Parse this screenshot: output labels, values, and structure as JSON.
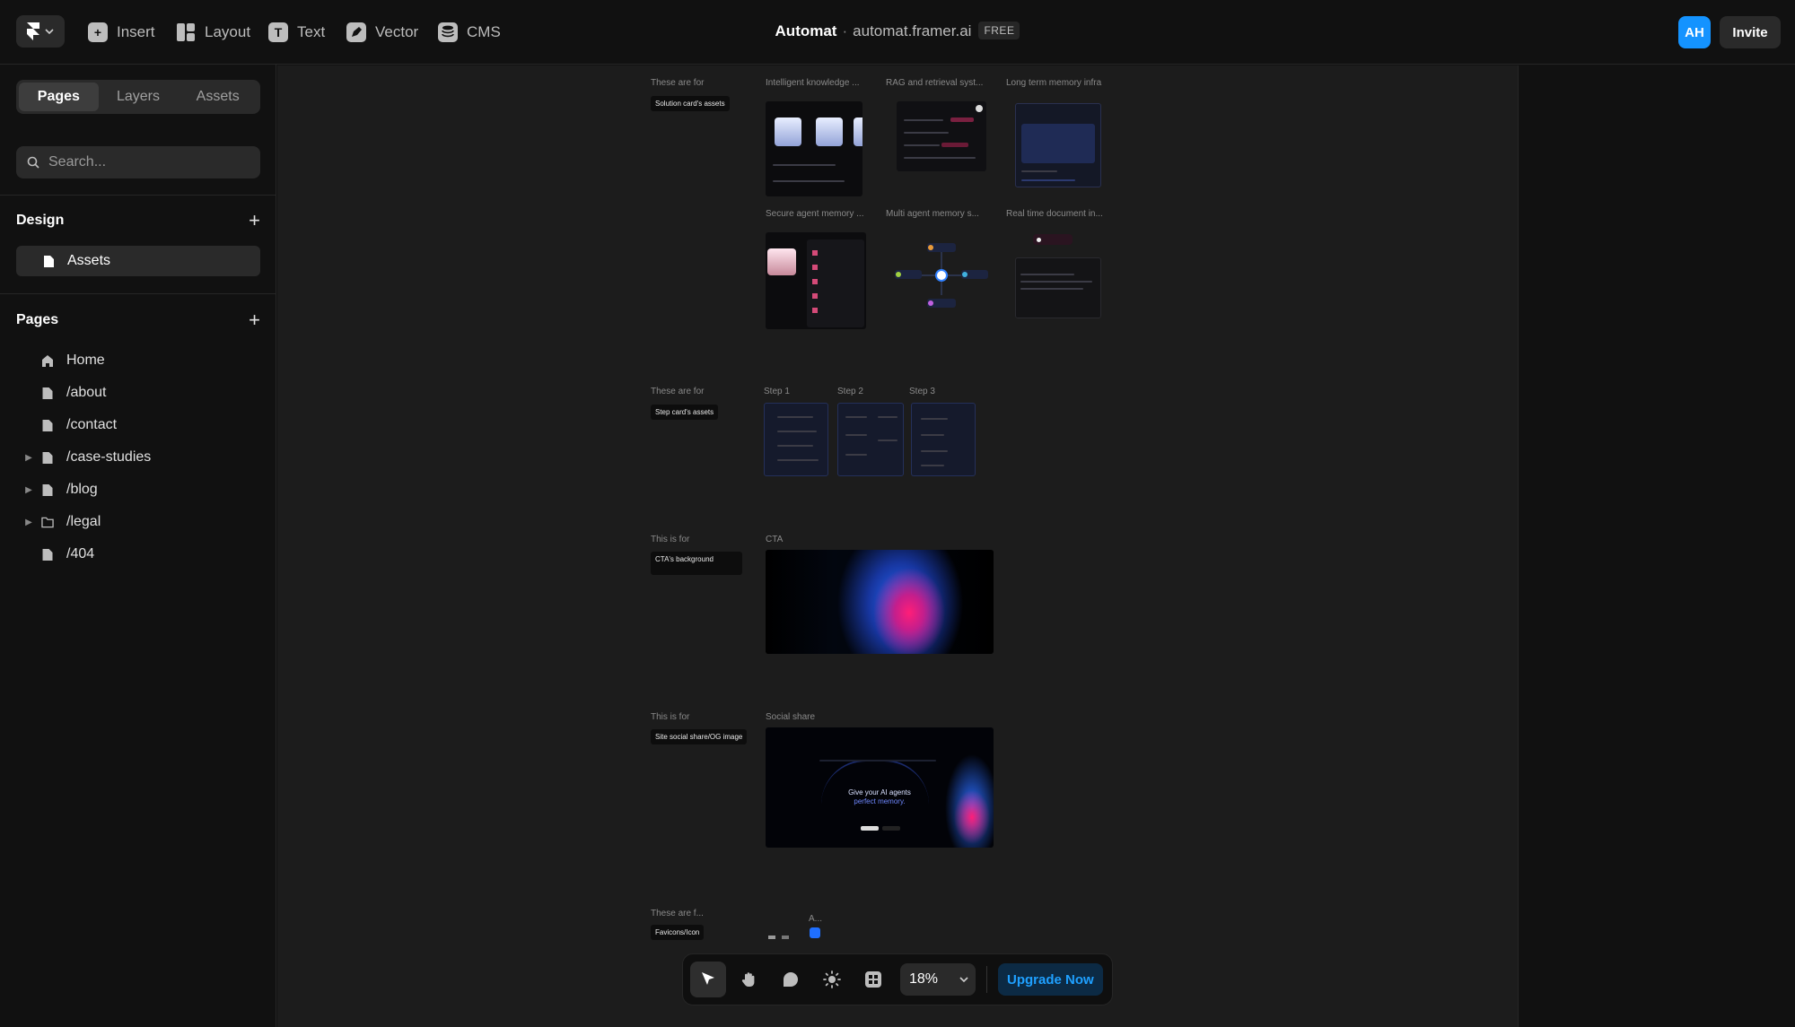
{
  "topbar": {
    "tools": [
      {
        "label": "Insert",
        "icon": "plus-square-icon"
      },
      {
        "label": "Layout",
        "icon": "layout-icon"
      },
      {
        "label": "Text",
        "icon": "text-icon"
      },
      {
        "label": "Vector",
        "icon": "pen-icon"
      },
      {
        "label": "CMS",
        "icon": "database-icon"
      }
    ],
    "project_name": "Automat",
    "separator": "·",
    "project_url": "automat.framer.ai",
    "plan_badge": "FREE",
    "avatar_initials": "AH",
    "invite_label": "Invite"
  },
  "left_panel": {
    "tabs": [
      "Pages",
      "Layers",
      "Assets"
    ],
    "active_tab": "Pages",
    "search_placeholder": "Search...",
    "design_section_title": "Design",
    "design_items": [
      "Assets"
    ],
    "pages_section_title": "Pages",
    "pages": [
      {
        "label": "Home",
        "icon": "home-icon",
        "expandable": false
      },
      {
        "label": "/about",
        "icon": "page-icon",
        "expandable": false
      },
      {
        "label": "/contact",
        "icon": "page-icon",
        "expandable": false
      },
      {
        "label": "/case-studies",
        "icon": "page-icon",
        "expandable": true
      },
      {
        "label": "/blog",
        "icon": "page-icon",
        "expandable": true
      },
      {
        "label": "/legal",
        "icon": "folder-icon",
        "expandable": true
      },
      {
        "label": "/404",
        "icon": "page-icon",
        "expandable": false
      }
    ]
  },
  "canvas": {
    "groups": [
      {
        "label": "These are for",
        "tag": "Solution card's assets"
      },
      {
        "label": "These are for",
        "tag": "Step card's assets"
      },
      {
        "label": "This is for",
        "tag": "CTA's background"
      },
      {
        "label": "This is for",
        "tag": "Site social share/OG image"
      },
      {
        "label": "These are f...",
        "tag": "Favicons/Icon"
      }
    ],
    "solution_frames": [
      "Intelligent knowledge ...",
      "RAG and retrieval syst...",
      "Long term memory infra",
      "Secure agent memory ...",
      "Multi agent memory s...",
      "Real time document in..."
    ],
    "step_frames": [
      "Step 1",
      "Step 2",
      "Step 3"
    ],
    "cta_frame": "CTA",
    "social_frame": "Social share",
    "social_headline_1": "Give your AI agents",
    "social_headline_2": "perfect memory.",
    "favicon_frame": "A..."
  },
  "toolbar": {
    "zoom": "18%",
    "upgrade_label": "Upgrade Now"
  },
  "colors": {
    "accent": "#1493ff",
    "background": "#111111",
    "canvas": "#1c1c1c"
  }
}
